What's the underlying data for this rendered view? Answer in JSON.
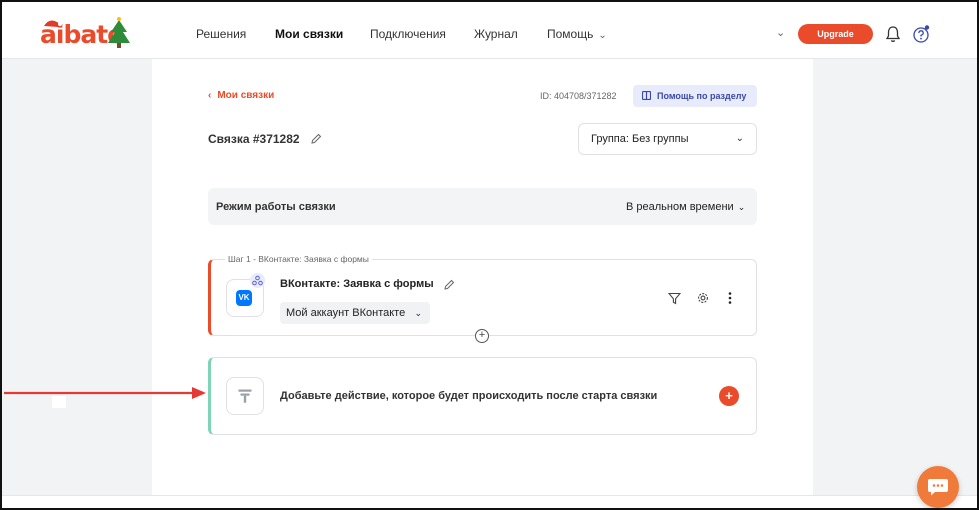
{
  "header": {
    "logo_text": "aibato",
    "nav": [
      {
        "label": "Решения",
        "active": false,
        "dropdown": false
      },
      {
        "label": "Мои связки",
        "active": true,
        "dropdown": false
      },
      {
        "label": "Подключения",
        "active": false,
        "dropdown": false
      },
      {
        "label": "Журнал",
        "active": false,
        "dropdown": false
      },
      {
        "label": "Помощь",
        "active": false,
        "dropdown": true
      }
    ],
    "upgrade_label": "Upgrade",
    "icons": [
      "chevron-down-icon",
      "bell-icon",
      "help-circle-icon"
    ]
  },
  "page": {
    "back_label": "Мои связки",
    "connection_id": "ID: 404708/371282",
    "help_button_label": "Помощь по разделу",
    "connection_title": "Связка #371282",
    "group_select_value": "Группа: Без группы"
  },
  "mode": {
    "label": "Режим работы связки",
    "value": "В реальном времени"
  },
  "step": {
    "legend": "Шаг 1 - ВКонтакте: Заявка с формы",
    "service_logo": "VK",
    "title": "ВКонтакте: Заявка с формы",
    "account_value": "Мой аккаунт ВКонтакте"
  },
  "action": {
    "text": "Добавьте действие, которое будет происходить после старта связки"
  },
  "colors": {
    "accent": "#ea4b2b",
    "vk": "#0077ff",
    "action_border": "#7fd3b6",
    "help_bg": "#e8ebfb",
    "chat": "#f07a3a"
  }
}
